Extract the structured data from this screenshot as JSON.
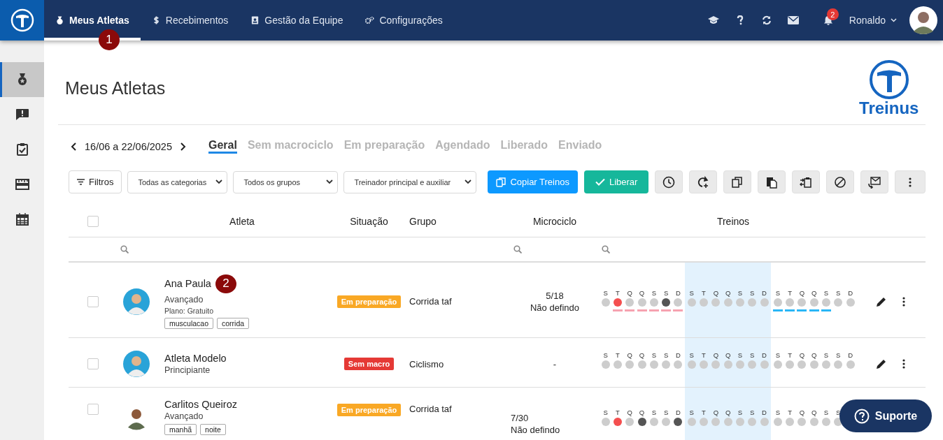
{
  "topbar": {
    "nav": [
      {
        "label": "Meus Atletas",
        "selected": true,
        "step": "1"
      },
      {
        "label": "Recebimentos",
        "selected": false
      },
      {
        "label": "Gestão da Equipe",
        "selected": false
      },
      {
        "label": "Configurações",
        "selected": false
      }
    ],
    "notifications": "2",
    "user": "Ronaldo"
  },
  "sidebar": {
    "items": [
      {
        "selected": true
      },
      {
        "selected": false
      },
      {
        "selected": false
      },
      {
        "selected": false
      },
      {
        "selected": false
      }
    ]
  },
  "page": {
    "title": "Meus Atletas",
    "brand": "Treinus"
  },
  "week_nav": {
    "range": "16/06 a 22/06/2025"
  },
  "tabs": [
    {
      "label": "Geral",
      "selected": true
    },
    {
      "label": "Sem macrociclo",
      "selected": false
    },
    {
      "label": "Em preparação",
      "selected": false
    },
    {
      "label": "Agendado",
      "selected": false
    },
    {
      "label": "Liberado",
      "selected": false
    },
    {
      "label": "Enviado",
      "selected": false
    }
  ],
  "toolbar": {
    "filters": "Filtros",
    "selects": [
      "Todas as categorias",
      "Todos os grupos",
      "Treinador principal e auxiliar"
    ],
    "copy": "Copiar Treinos",
    "release": "Liberar"
  },
  "table": {
    "select_all": {
      "checked": false
    },
    "columns": [
      "Atleta",
      "Situação",
      "Grupo",
      "Microciclo",
      "Treinos"
    ],
    "rows": [
      {
        "checked": false,
        "name": "Ana Paula",
        "step": "2",
        "level": "Avançado",
        "plan": "Plano: Gratuito",
        "tags": [
          "musculacao",
          "corrida"
        ],
        "status": {
          "label": "Em preparação",
          "color": "#f9a825"
        },
        "group": "Corrida taf",
        "micro": [
          "5/18",
          "Não defindo"
        ],
        "actions": true,
        "weeks": [
          {
            "highlighted": false,
            "days": [
              {
                "letter": "S",
                "color": "#cdcdcd"
              },
              {
                "letter": "T",
                "color": "#f44f4f",
                "bar": {
                  "color": "#f6a2b0"
                }
              },
              {
                "letter": "Q",
                "color": "#cdcdcd",
                "bar": {
                  "color": "#f6a2b0"
                }
              },
              {
                "letter": "Q",
                "color": "#cdcdcd",
                "bar": {
                  "color": "#f6a2b0"
                }
              },
              {
                "letter": "S",
                "color": "#cdcdcd",
                "bar": {
                  "color": "#f6a2b0"
                }
              },
              {
                "letter": "S",
                "color": "#555555",
                "bar": {
                  "color": "#f6a2b0"
                }
              },
              {
                "letter": "D",
                "color": "#cdcdcd",
                "bar": {
                  "color": "#f6a2b0"
                }
              }
            ]
          },
          {
            "highlighted": true,
            "days": [
              {
                "letter": "S",
                "color": "#cdcdcd"
              },
              {
                "letter": "T",
                "color": "#cdcdcd"
              },
              {
                "letter": "Q",
                "color": "#cdcdcd"
              },
              {
                "letter": "Q",
                "color": "#cdcdcd"
              },
              {
                "letter": "S",
                "color": "#cdcdcd"
              },
              {
                "letter": "S",
                "color": "#cdcdcd"
              },
              {
                "letter": "D",
                "color": "#cdcdcd"
              }
            ]
          },
          {
            "highlighted": false,
            "days": [
              {
                "letter": "S",
                "color": "#cdcdcd",
                "bar": {
                  "color": "#29b6f6"
                }
              },
              {
                "letter": "T",
                "color": "#cdcdcd",
                "bar": {
                  "color": "#29b6f6"
                }
              },
              {
                "letter": "Q",
                "color": "#cdcdcd",
                "bar": {
                  "color": "#29b6f6"
                }
              },
              {
                "letter": "Q",
                "color": "#cdcdcd",
                "bar": {
                  "color": "#29b6f6"
                }
              },
              {
                "letter": "S",
                "color": "#cdcdcd",
                "bar": {
                  "color": "#29b6f6"
                }
              },
              {
                "letter": "S",
                "color": "#cdcdcd"
              },
              {
                "letter": "D",
                "color": "#cdcdcd"
              }
            ]
          }
        ]
      },
      {
        "checked": false,
        "name": "Atleta Modelo",
        "level": "Principiante",
        "tags": [],
        "status": {
          "label": "Sem macro",
          "color": "#e53935"
        },
        "group": "Ciclismo",
        "micro": [
          "-"
        ],
        "actions": true,
        "weeks": [
          {
            "highlighted": false,
            "days": [
              {
                "letter": "S",
                "color": "#cdcdcd"
              },
              {
                "letter": "T",
                "color": "#cdcdcd"
              },
              {
                "letter": "Q",
                "color": "#cdcdcd"
              },
              {
                "letter": "Q",
                "color": "#cdcdcd"
              },
              {
                "letter": "S",
                "color": "#cdcdcd"
              },
              {
                "letter": "S",
                "color": "#cdcdcd"
              },
              {
                "letter": "D",
                "color": "#cdcdcd"
              }
            ]
          },
          {
            "highlighted": true,
            "days": [
              {
                "letter": "S",
                "color": "#cdcdcd"
              },
              {
                "letter": "T",
                "color": "#cdcdcd"
              },
              {
                "letter": "Q",
                "color": "#cdcdcd"
              },
              {
                "letter": "Q",
                "color": "#cdcdcd"
              },
              {
                "letter": "S",
                "color": "#cdcdcd"
              },
              {
                "letter": "S",
                "color": "#cdcdcd"
              },
              {
                "letter": "D",
                "color": "#cdcdcd"
              }
            ]
          },
          {
            "highlighted": false,
            "days": [
              {
                "letter": "S",
                "color": "#cdcdcd"
              },
              {
                "letter": "T",
                "color": "#cdcdcd"
              },
              {
                "letter": "Q",
                "color": "#cdcdcd"
              },
              {
                "letter": "Q",
                "color": "#cdcdcd"
              },
              {
                "letter": "S",
                "color": "#cdcdcd"
              },
              {
                "letter": "S",
                "color": "#cdcdcd"
              },
              {
                "letter": "D",
                "color": "#cdcdcd"
              }
            ]
          }
        ]
      },
      {
        "checked": false,
        "name": "Carlitos Queiroz",
        "level": "Avançado",
        "tags": [
          "manhã",
          "noite"
        ],
        "status": {
          "label": "Em preparação",
          "color": "#f9a825"
        },
        "group": "Corrida taf",
        "micro": [
          "7/30",
          "Não defindo"
        ],
        "actions": false,
        "weeks": [
          {
            "highlighted": false,
            "days": [
              {
                "letter": "S",
                "color": "#cdcdcd"
              },
              {
                "letter": "T",
                "color": "#f44f4f"
              },
              {
                "letter": "Q",
                "color": "#cdcdcd"
              },
              {
                "letter": "Q",
                "color": "#555555"
              },
              {
                "letter": "S",
                "color": "#cdcdcd"
              },
              {
                "letter": "S",
                "color": "#cdcdcd"
              },
              {
                "letter": "D",
                "color": "#555555"
              }
            ]
          },
          {
            "highlighted": true,
            "days": [
              {
                "letter": "S",
                "color": "#cdcdcd"
              },
              {
                "letter": "T",
                "color": "#cdcdcd"
              },
              {
                "letter": "Q",
                "color": "#cdcdcd"
              },
              {
                "letter": "Q",
                "color": "#cdcdcd"
              },
              {
                "letter": "S",
                "color": "#cdcdcd"
              },
              {
                "letter": "S",
                "color": "#cdcdcd"
              },
              {
                "letter": "D",
                "color": "#cdcdcd"
              }
            ]
          },
          {
            "highlighted": false,
            "days": [
              {
                "letter": "S",
                "color": "#cdcdcd"
              },
              {
                "letter": "T",
                "color": "#cdcdcd"
              },
              {
                "letter": "Q",
                "color": "#cdcdcd"
              },
              {
                "letter": "Q",
                "color": "#cdcdcd"
              },
              {
                "letter": "S",
                "color": "#cdcdcd"
              },
              {
                "letter": "S",
                "color": "#cdcdcd"
              }
            ]
          }
        ]
      }
    ]
  },
  "support": "Suporte"
}
